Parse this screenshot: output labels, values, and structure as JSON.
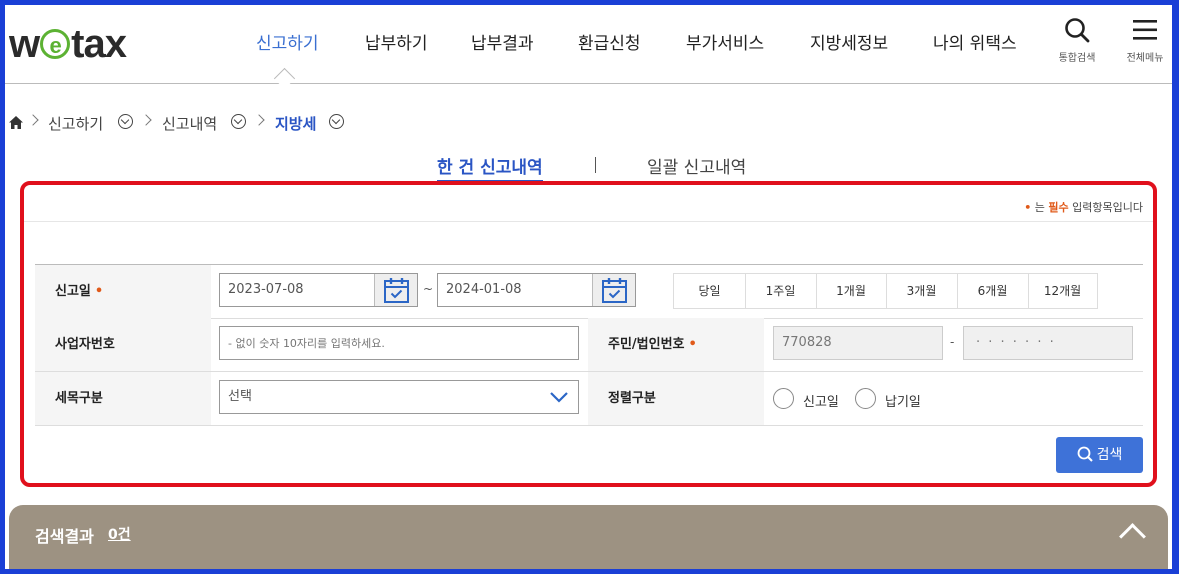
{
  "logo": {
    "pre": "w",
    "mid": "e",
    "post": "tax"
  },
  "nav": [
    "신고하기",
    "납부하기",
    "납부결과",
    "환급신청",
    "부가서비스",
    "지방세정보",
    "나의 위택스"
  ],
  "tools": {
    "search": "통합검색",
    "menu": "전체메뉴"
  },
  "breadcrumb": [
    "신고하기",
    "신고내역",
    "지방세"
  ],
  "tabs": [
    "한 건 신고내역",
    "일괄 신고내역"
  ],
  "required_note": {
    "dot": "•",
    "pre": "는 ",
    "must": "필수",
    "post": " 입력항목입니다"
  },
  "form": {
    "report_date": {
      "label": "신고일",
      "req": "•",
      "from": "2023-07-08",
      "tilde": "~",
      "to": "2024-01-08"
    },
    "periods": [
      "당일",
      "1주일",
      "1개월",
      "3개월",
      "6개월",
      "12개월"
    ],
    "biz_no": {
      "label": "사업자번호",
      "placeholder": "- 없이 숫자 10자리를 입력하세요."
    },
    "resident_no": {
      "label": "주민/법인번호",
      "req": "•",
      "front": "770828",
      "dash": "-",
      "back": "· · · · · · ·"
    },
    "tax_type": {
      "label": "세목구분",
      "value": "선택"
    },
    "sort": {
      "label": "정렬구분",
      "options": [
        "신고일",
        "납기일"
      ]
    },
    "search_label": "검색"
  },
  "results": {
    "title": "검색결과",
    "count": "0건"
  }
}
